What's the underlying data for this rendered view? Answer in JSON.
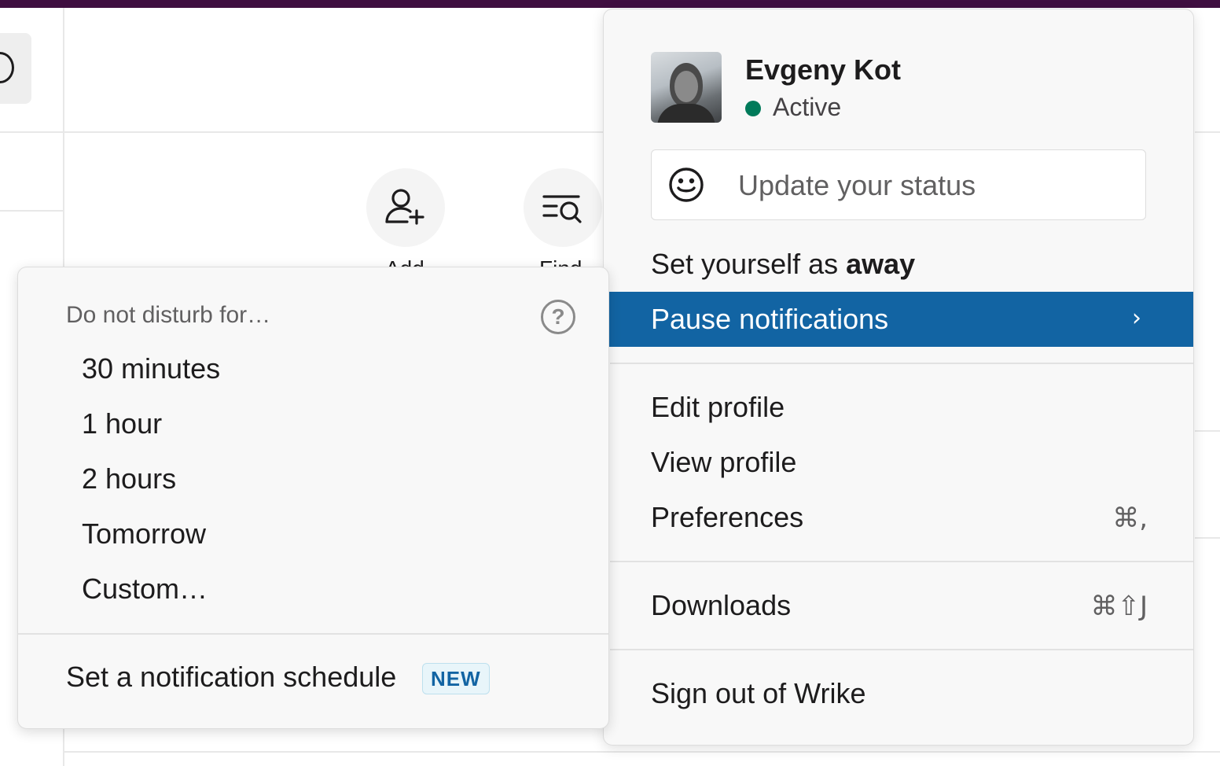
{
  "background": {
    "add_button_label": "Add",
    "find_button_label": "Find"
  },
  "profile": {
    "name": "Evgeny Kot",
    "status": "Active",
    "status_color": "#007a5a"
  },
  "status_input": {
    "placeholder": "Update your status"
  },
  "menu": {
    "away_prefix": "Set yourself as ",
    "away_bold": "away",
    "pause_notifications": "Pause notifications",
    "edit_profile": "Edit profile",
    "view_profile": "View profile",
    "preferences": "Preferences",
    "preferences_shortcut": "⌘,",
    "downloads": "Downloads",
    "downloads_shortcut": "⌘⇧J",
    "sign_out": "Sign out of Wrike",
    "accent_color": "#1264a3"
  },
  "submenu": {
    "header": "Do not disturb for…",
    "options": [
      "30 minutes",
      "1 hour",
      "2 hours",
      "Tomorrow",
      "Custom…"
    ],
    "schedule_label": "Set a notification schedule",
    "new_badge": "NEW"
  }
}
